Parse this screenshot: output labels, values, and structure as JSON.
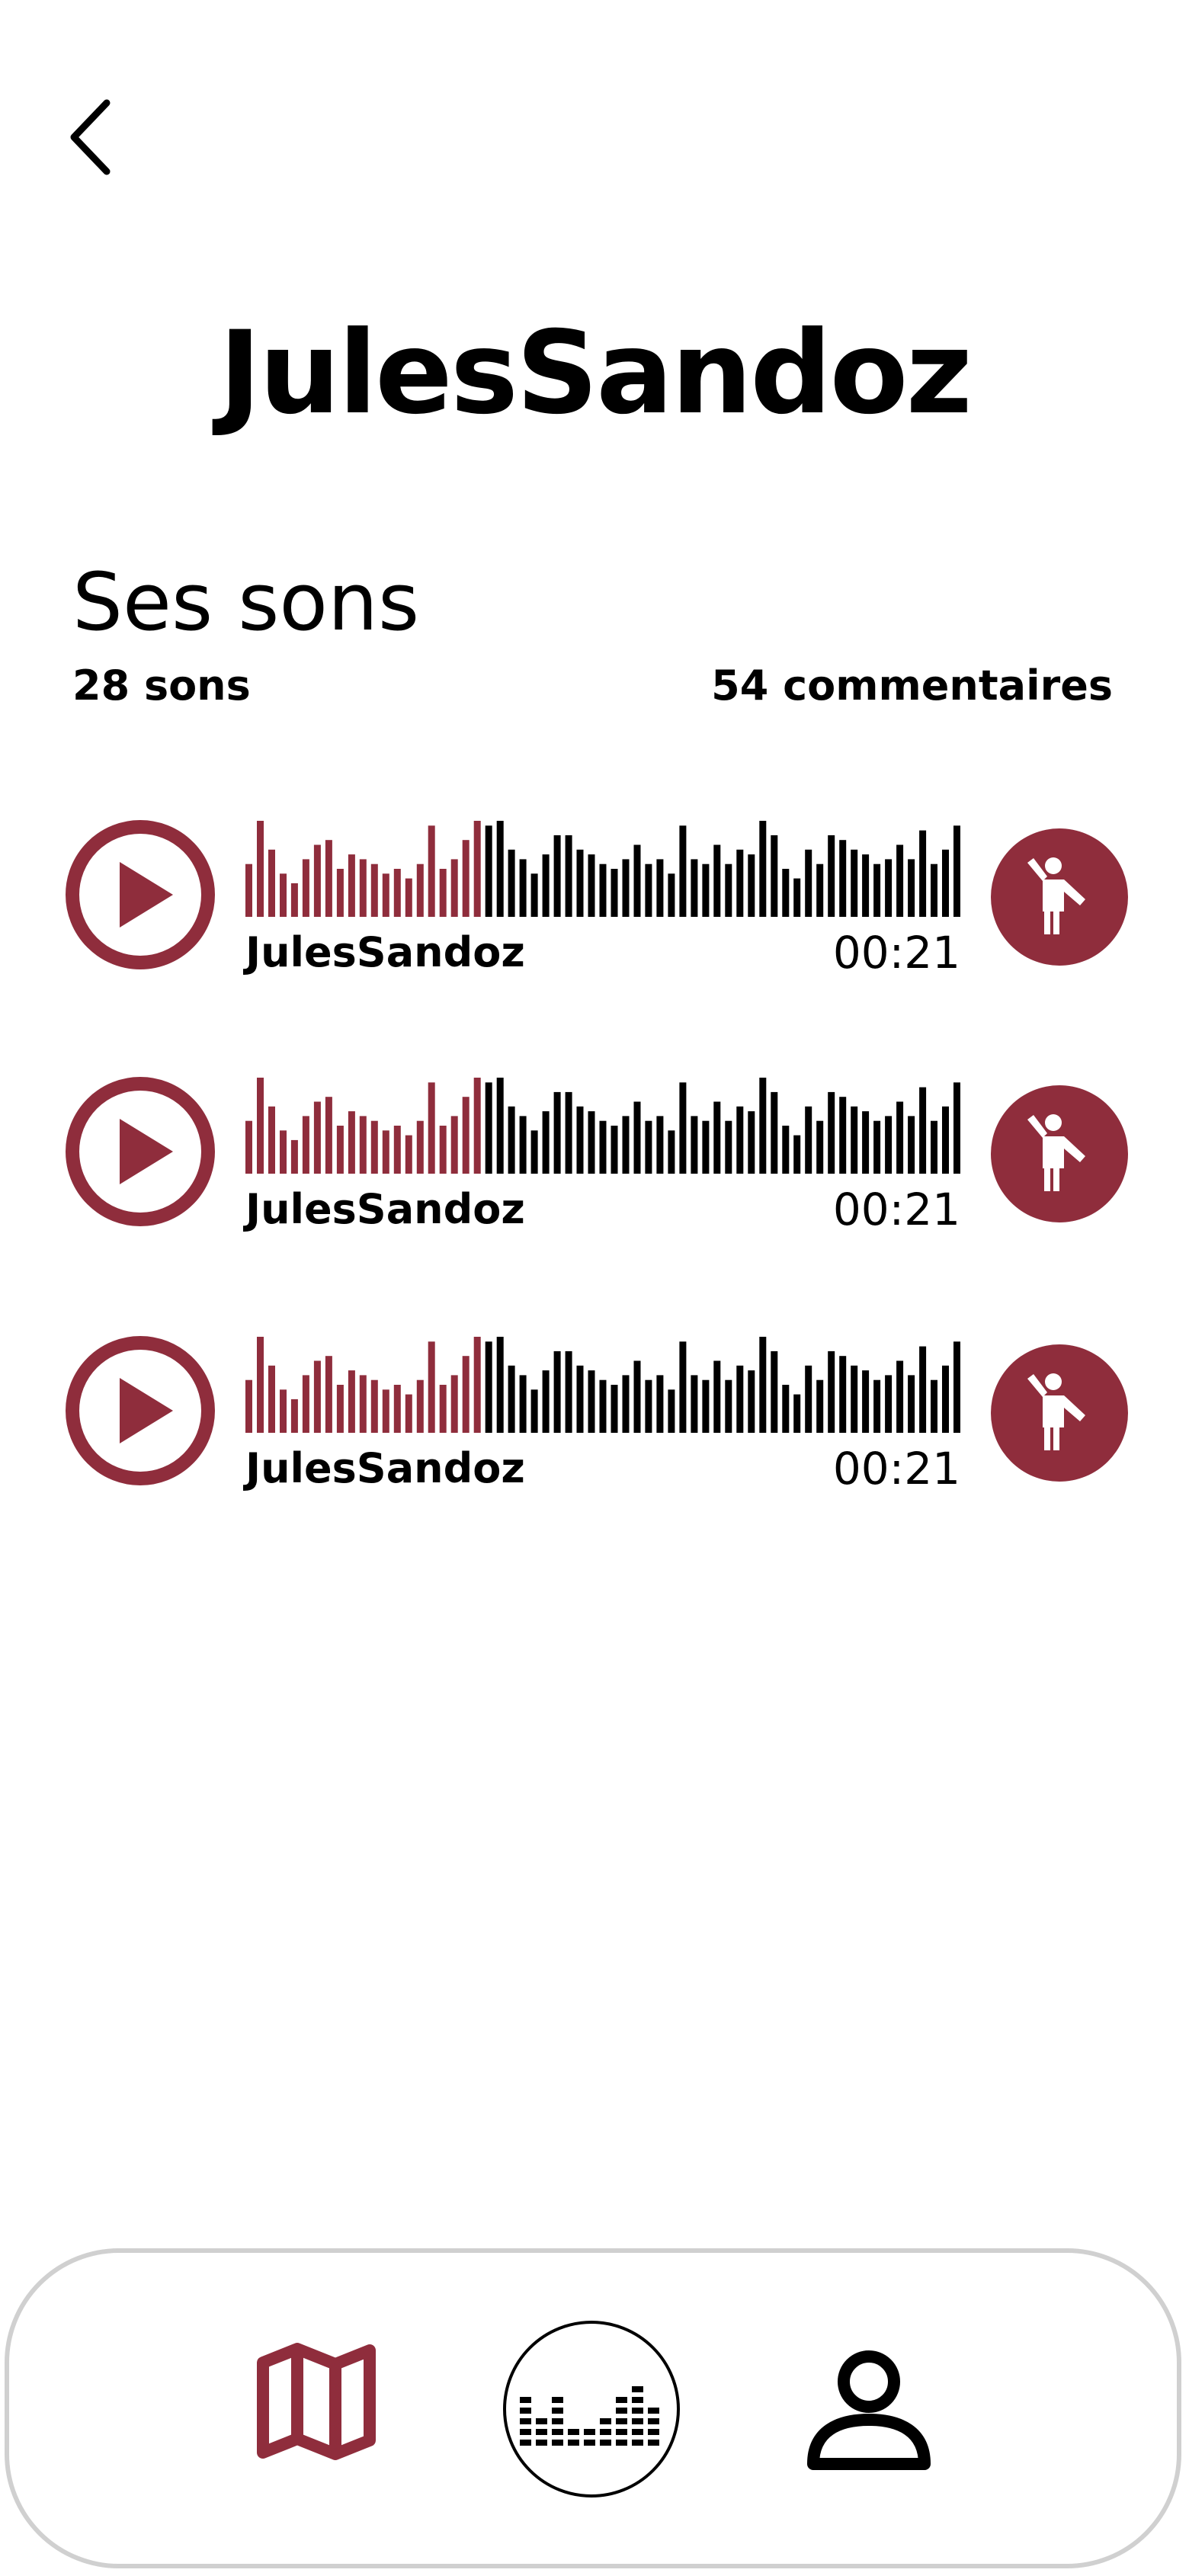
{
  "header": {
    "back_icon": "chevron-left-icon"
  },
  "profile": {
    "name": "JulesSandoz"
  },
  "sounds_section": {
    "title": "Ses sons",
    "sounds_count": "28 sons",
    "comments_count": "54 commentaires"
  },
  "tracks": [
    {
      "author": "JulesSandoz",
      "duration": "00:21",
      "progress": 0.33
    },
    {
      "author": "JulesSandoz",
      "duration": "00:21",
      "progress": 0.33
    },
    {
      "author": "JulesSandoz",
      "duration": "00:21",
      "progress": 0.33
    }
  ],
  "bottom_nav": {
    "items": [
      {
        "icon": "map-icon"
      },
      {
        "icon": "equalizer-icon"
      },
      {
        "icon": "user-icon"
      }
    ]
  },
  "colors": {
    "accent": "#8f2d3c",
    "text": "#000000",
    "border": "#d0d0d0"
  }
}
